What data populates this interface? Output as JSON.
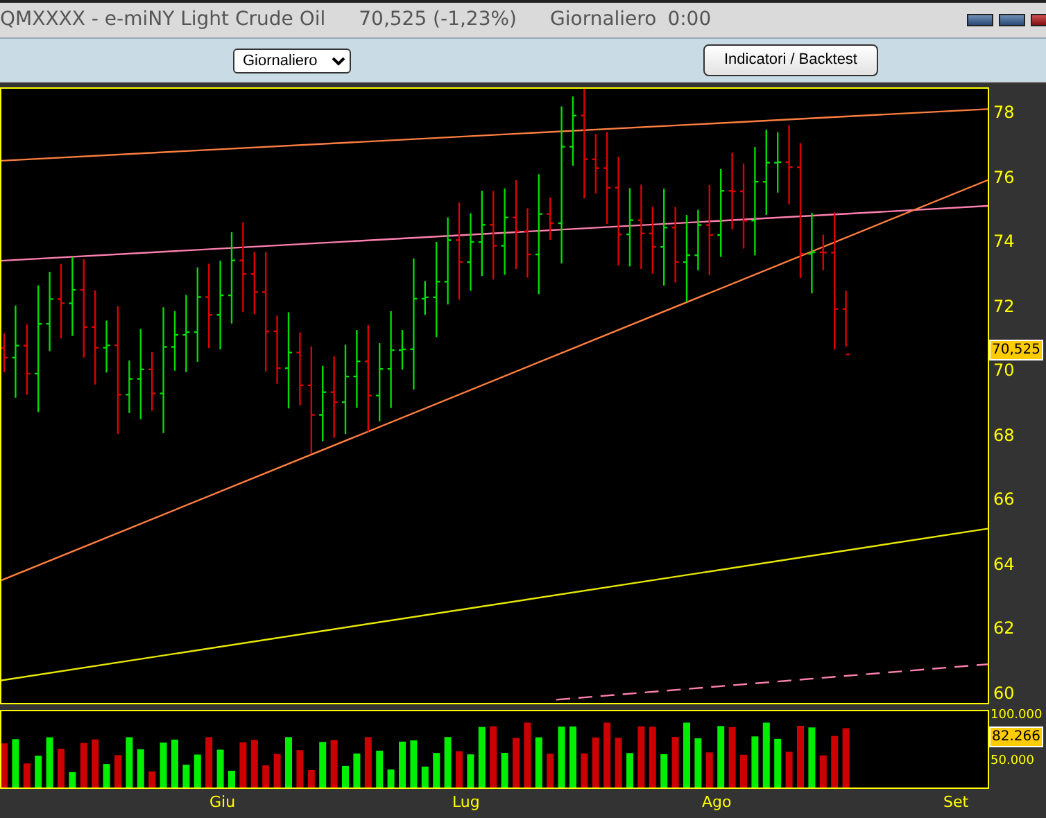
{
  "window": {
    "title": "QMXXXX - e-miNY Light Crude Oil",
    "price": "70,525 (-1,23%)",
    "period": "Giornaliero",
    "time": "0:00"
  },
  "toolbar": {
    "period_select": {
      "value": "Giornaliero"
    },
    "indicators_button": "Indicatori / Backtest"
  },
  "price_chart": {
    "y_axis_labels": [
      "78",
      "76",
      "74",
      "72",
      "70",
      "68",
      "66",
      "64",
      "62",
      "60"
    ],
    "last_price_tag": "70,525"
  },
  "volume_chart": {
    "axis_labels": [
      "100.000",
      "50.000"
    ],
    "last_volume_tag": "82.266"
  },
  "x_axis_labels": [
    "Giu",
    "Lug",
    "Ago",
    "Set"
  ]
}
